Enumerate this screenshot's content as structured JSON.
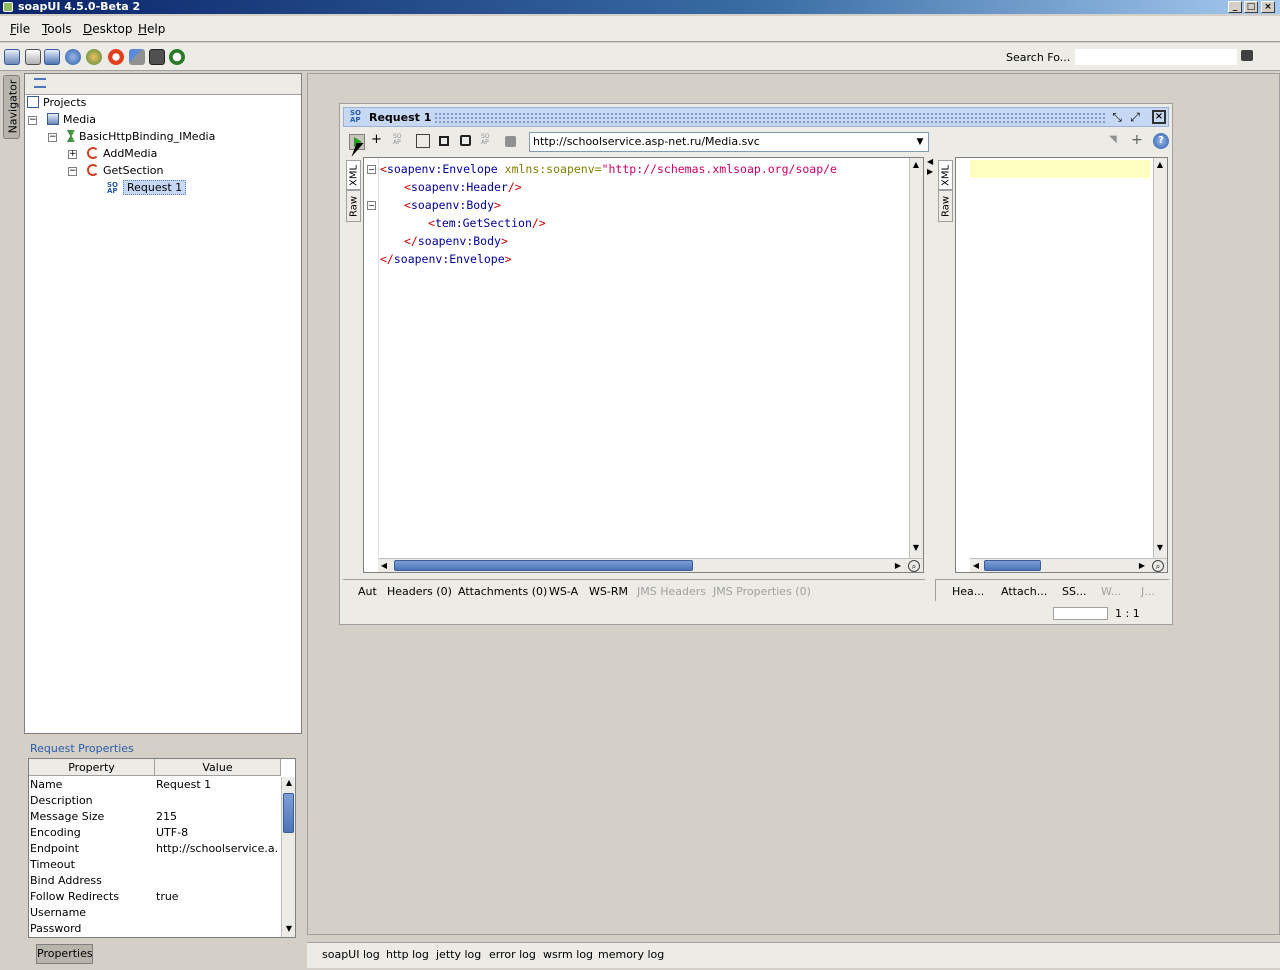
{
  "window": {
    "title": "soapUI 4.5.0-Beta 2",
    "controls": [
      "_",
      "□",
      "×"
    ]
  },
  "menubar": {
    "items": [
      {
        "first": "F",
        "rest": "ile"
      },
      {
        "first": "T",
        "rest": "ools"
      },
      {
        "first": "D",
        "rest": "esktop"
      },
      {
        "first": "H",
        "rest": "elp"
      }
    ]
  },
  "toolbar": {
    "icons": [
      "new-project-icon",
      "import-project-icon",
      "save-all-icon",
      "help-icon",
      "forum-icon",
      "soapui-pro-icon",
      "preferences-icon",
      "monitor-icon",
      "exit-icon"
    ],
    "search_label": "Search Fo...",
    "search_value": ""
  },
  "navigator": {
    "tab_label": "Navigator",
    "tree": {
      "projects": "Projects",
      "project": "Media",
      "interface": "BasicHttpBinding_IMedia",
      "operation1": "AddMedia",
      "operation2": "GetSection",
      "request": "Request 1"
    }
  },
  "properties": {
    "title": "Request Properties",
    "headers": [
      "Property",
      "Value"
    ],
    "rows": [
      {
        "name": "Name",
        "value": "Request 1"
      },
      {
        "name": "Description",
        "value": ""
      },
      {
        "name": "Message Size",
        "value": "215"
      },
      {
        "name": "Encoding",
        "value": "UTF-8"
      },
      {
        "name": "Endpoint",
        "value": "http://schoolservice.a..."
      },
      {
        "name": "Timeout",
        "value": ""
      },
      {
        "name": "Bind Address",
        "value": ""
      },
      {
        "name": "Follow Redirects",
        "value": "true"
      },
      {
        "name": "Username",
        "value": ""
      },
      {
        "name": "Password",
        "value": ""
      }
    ],
    "button": "Properties"
  },
  "request_window": {
    "title": "Request 1",
    "endpoint": "http://schoolservice.asp-net.ru/Media.svc",
    "request_side_tabs": [
      "XML",
      "Raw"
    ],
    "response_side_tabs": [
      "XML",
      "Raw"
    ],
    "xml": {
      "l1_open": "<",
      "l1_tag": "soapenv:Envelope",
      "l1_attr": " xmlns:soapenv=",
      "l1_val": "\"http://schemas.xmlsoap.org/soap/e",
      "l2_tag": "soapenv:Header",
      "l3_tag": "soapenv:Body",
      "l4_tag": "tem:GetSection",
      "l5_tag": "soapenv:Body",
      "l6_tag": "soapenv:Envelope"
    },
    "request_bottom_tabs": [
      {
        "label": "Aut",
        "disabled": false
      },
      {
        "label": "Headers (0)",
        "disabled": false
      },
      {
        "label": "Attachments (0)",
        "disabled": false
      },
      {
        "label": "WS-A",
        "disabled": false
      },
      {
        "label": "WS-RM",
        "disabled": false
      },
      {
        "label": "JMS Headers",
        "disabled": true
      },
      {
        "label": "JMS Properties (0)",
        "disabled": true
      }
    ],
    "response_bottom_tabs": [
      {
        "label": "Hea...",
        "disabled": false
      },
      {
        "label": "Attach...",
        "disabled": false
      },
      {
        "label": "SS...",
        "disabled": false
      },
      {
        "label": "W...",
        "disabled": true
      },
      {
        "label": "J...",
        "disabled": true
      }
    ],
    "cursor_position": "1 : 1"
  },
  "logs": [
    "soapUI log",
    "http log",
    "jetty log",
    "error log",
    "wsrm log",
    "memory log"
  ],
  "colors": {
    "accent": "#0a246a",
    "selection": "#c7d8f4",
    "response_highlight": "#ffffc0"
  }
}
